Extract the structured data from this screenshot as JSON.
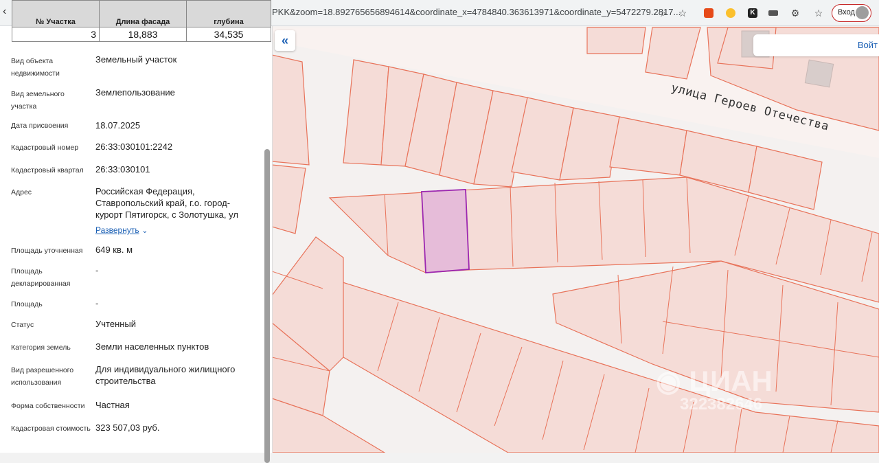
{
  "browser": {
    "url": "PKK&zoom=18.892765656894614&coordinate_x=4784840.363613971&coordinate_y=5472279.2817...",
    "login_label": "Вход"
  },
  "table": {
    "headers": [
      "№ Участка",
      "Длина фасада",
      "глубина"
    ],
    "row": [
      "3",
      "18,883",
      "34,535"
    ]
  },
  "details": {
    "expand_label": "Развернуть",
    "rows": [
      {
        "label": "Вид объекта недвижимости",
        "value": "Земельный участок"
      },
      {
        "label": "Вид земельного участка",
        "value": "Землепользование"
      },
      {
        "label": "Дата присвоения",
        "value": "18.07.2025"
      },
      {
        "label": "Кадастровый номер",
        "value": "26:33:030101:2242"
      },
      {
        "label": "Кадастровый квартал",
        "value": "26:33:030101"
      },
      {
        "label": "Адрес",
        "value": "Российская Федерация, Ставропольский край, г.о. город-курорт Пятигорск, с Золотушка, ул"
      },
      {
        "label": "Площадь уточненная",
        "value": "649 кв. м"
      },
      {
        "label": "Площадь декларированная",
        "value": "-"
      },
      {
        "label": "Площадь",
        "value": "-"
      },
      {
        "label": "Статус",
        "value": "Учтенный"
      },
      {
        "label": "Категория земель",
        "value": "Земли населенных пунктов"
      },
      {
        "label": "Вид разрешенного использования",
        "value": "Для индивидуального жилищного строительства"
      },
      {
        "label": "Форма собственности",
        "value": "Частная"
      },
      {
        "label": "Кадастровая стоимость",
        "value": "323 507,03 руб."
      }
    ]
  },
  "map": {
    "street_name": "улица Героев Отечества",
    "login_label": "Войт",
    "watermark_logo": "ЦИАН",
    "watermark_id": "322382646",
    "colors": {
      "parcel_stroke": "#e8735a",
      "parcel_fill": "#f5dcd7",
      "selected_stroke": "#9c27b0",
      "selected_fill": "#e6bcd9"
    }
  }
}
